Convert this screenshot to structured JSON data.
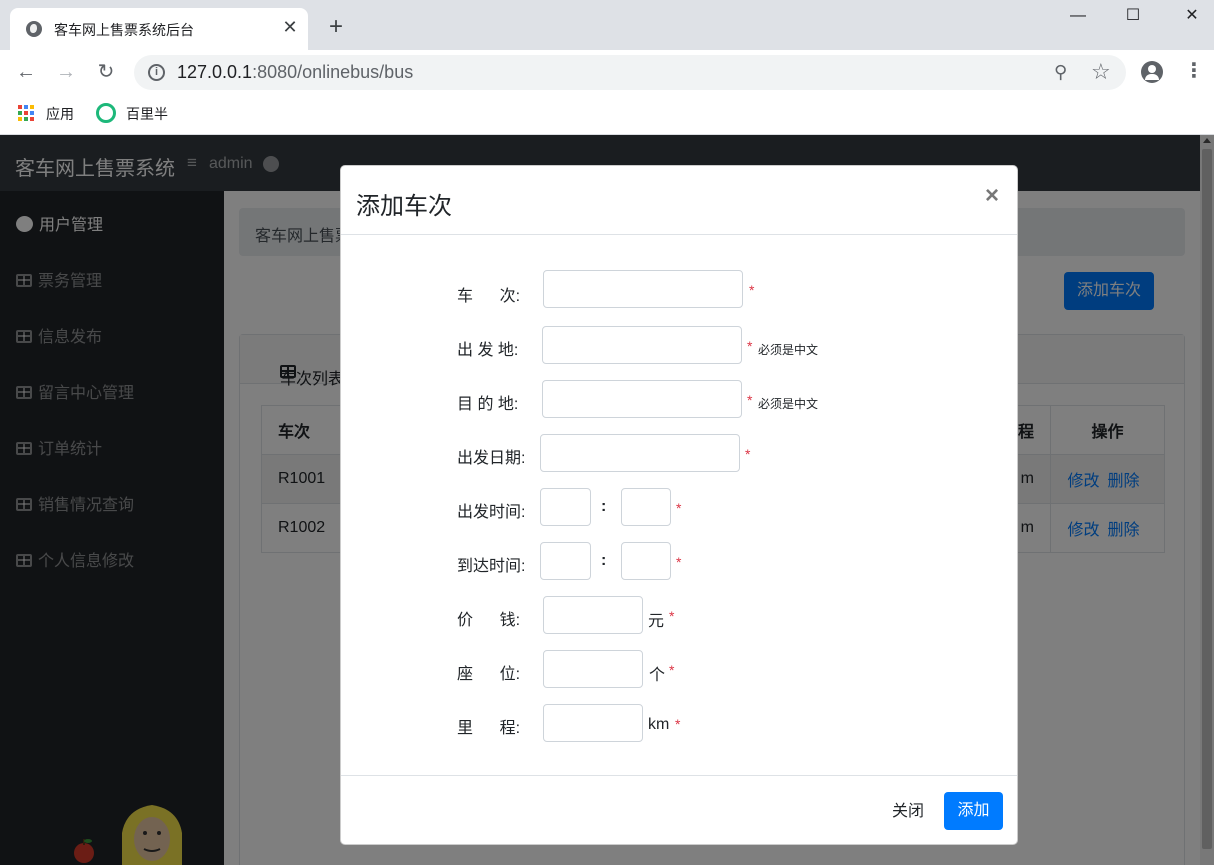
{
  "browser": {
    "tab_title": "客车网上售票系统后台",
    "url_host": "127.0.0.1",
    "url_rest": ":8080/onlinebus/bus",
    "bookmarks": [
      "应用",
      "百里半"
    ]
  },
  "navbar": {
    "brand": "客车网上售票系统",
    "user": "admin"
  },
  "sidebar": {
    "items": [
      {
        "label": "用户管理",
        "active": true
      },
      {
        "label": "票务管理"
      },
      {
        "label": "信息发布"
      },
      {
        "label": "留言中心管理"
      },
      {
        "label": "订单统计"
      },
      {
        "label": "销售情况查询"
      },
      {
        "label": "个人信息修改"
      }
    ]
  },
  "main": {
    "breadcrumb": "客车网上售票",
    "add_button": "添加车次",
    "card_title": "车次列表",
    "table": {
      "headers": [
        "车次",
        "程",
        "操作"
      ],
      "rows": [
        {
          "no": "R1001",
          "dist_tail": "m",
          "edit": "修改",
          "delete": "删除"
        },
        {
          "no": "R1002",
          "dist_tail": "m",
          "edit": "修改",
          "delete": "删除"
        }
      ]
    }
  },
  "modal": {
    "title": "添加车次",
    "close_symbol": "×",
    "fields": {
      "train_no": "车      次:",
      "departure": "出 发 地:",
      "destination": "目 的 地:",
      "date": "出发日期:",
      "depart_time": "出发时间:",
      "arrive_time": "到达时间:",
      "price": "价      钱:",
      "seats": "座      位:",
      "distance": "里      程:"
    },
    "required_mark": "*",
    "hint_chinese": "必须是中文",
    "time_colon": ":",
    "units": {
      "price": "元",
      "seats": "个",
      "distance": "km"
    },
    "close_button": "关闭",
    "submit_button": "添加"
  },
  "colors": {
    "primary": "#007bff",
    "danger": "#dc3545",
    "navbar": "#343a40",
    "sidebar": "#212529"
  }
}
